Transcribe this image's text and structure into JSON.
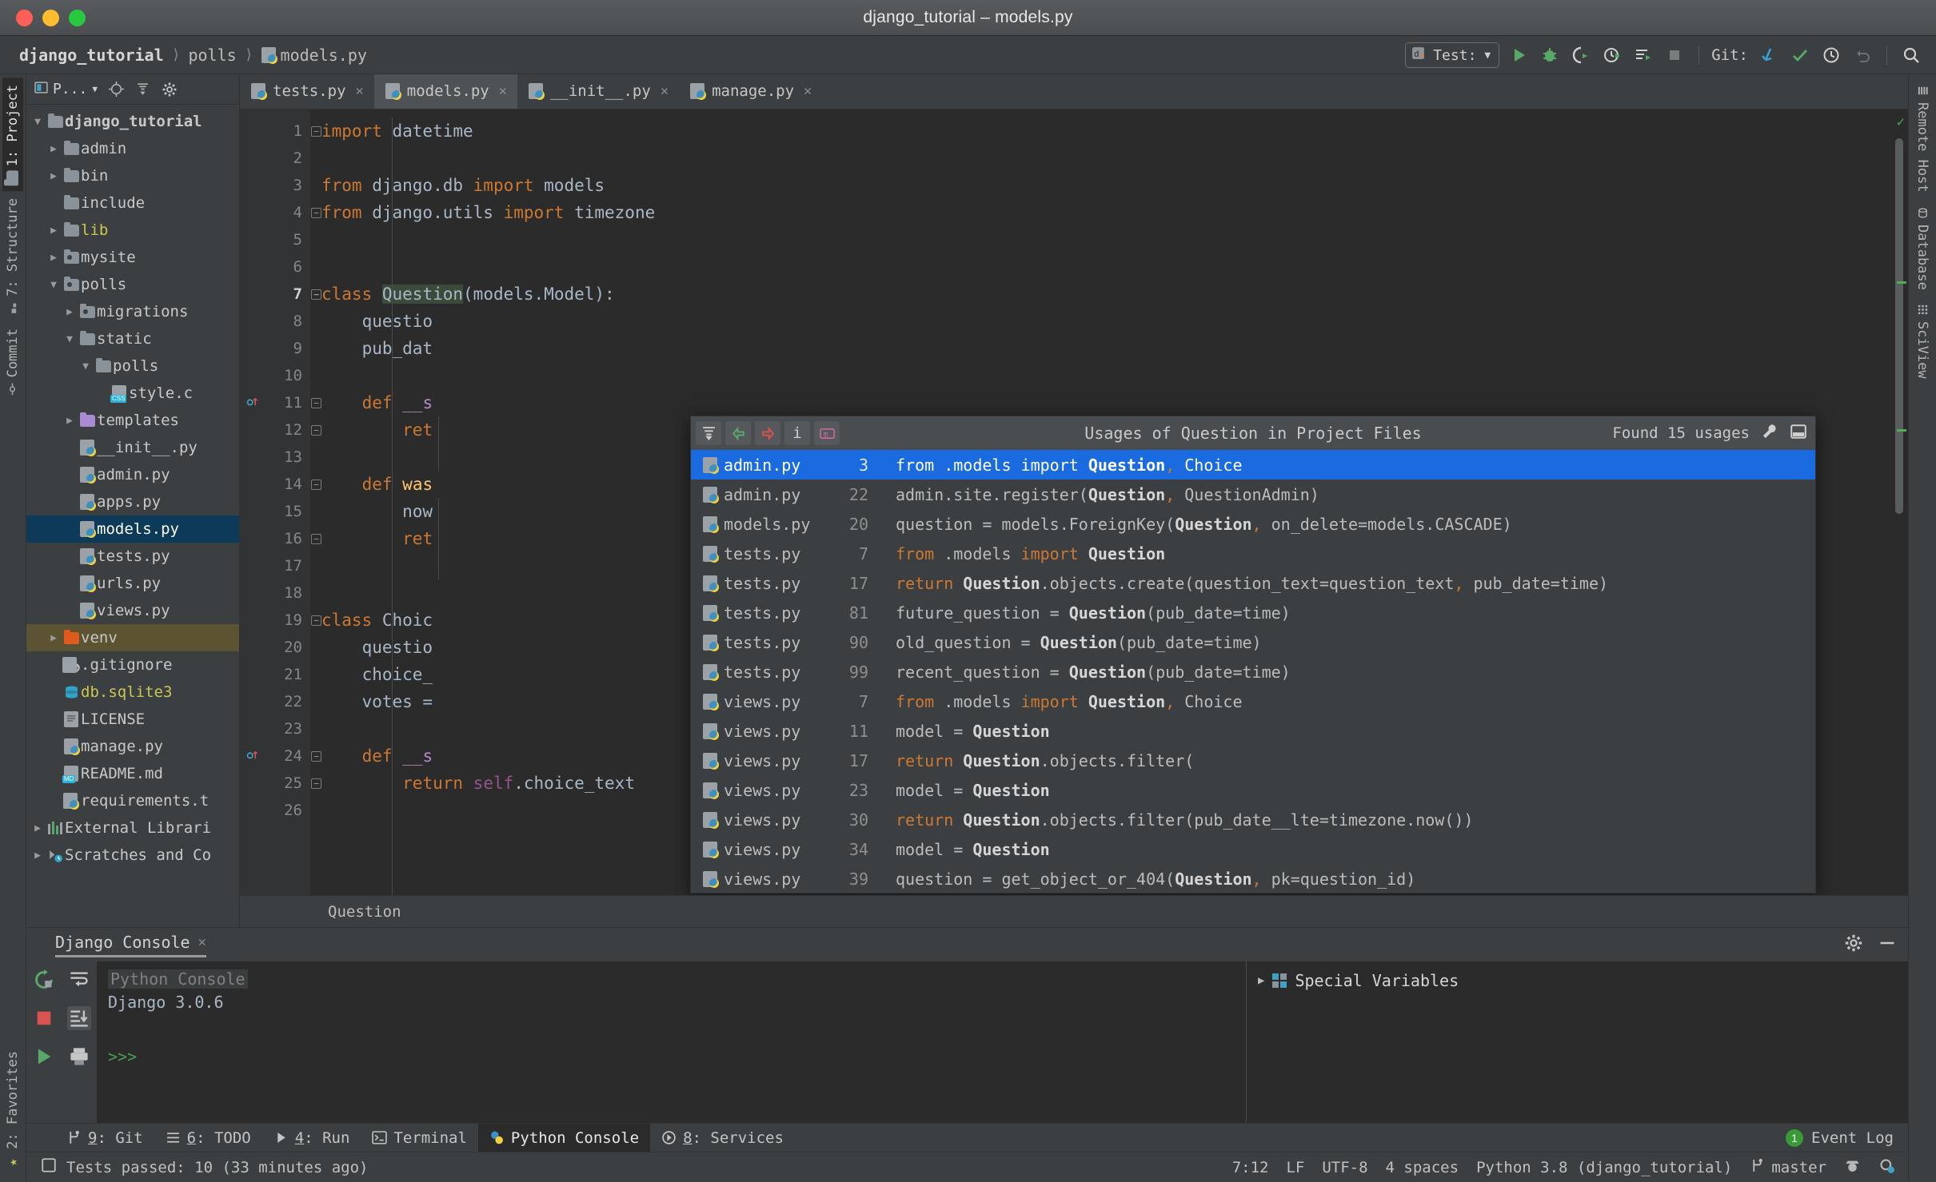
{
  "window": {
    "title": "django_tutorial – models.py",
    "traffic_lights": [
      "close",
      "minimize",
      "zoom"
    ]
  },
  "navbar": {
    "breadcrumbs": [
      "django_tutorial",
      "polls",
      "models.py"
    ],
    "run_config_label": "Test:",
    "git_label": "Git:",
    "icons": [
      "run-icon",
      "debug-icon",
      "run-coverage-icon",
      "profile-icon",
      "run-with-console-icon",
      "stop-icon",
      "git-update-icon",
      "git-commit-icon",
      "git-history-icon",
      "git-rollback-icon",
      "search-everywhere-icon"
    ]
  },
  "left_strip": {
    "tabs": [
      {
        "label": "1: Project",
        "icon": "folder-icon",
        "active": true
      },
      {
        "label": "7: Structure",
        "icon": "structure-icon",
        "active": false
      },
      {
        "label": "Commit",
        "icon": "commit-icon",
        "active": false
      }
    ],
    "bottom_tabs": [
      {
        "label": "2: Favorites",
        "icon": "star-icon"
      }
    ]
  },
  "right_strip": {
    "tabs": [
      {
        "label": "Remote Host",
        "icon": "remote-host-icon"
      },
      {
        "label": "Database",
        "icon": "database-icon"
      },
      {
        "label": "SciView",
        "icon": "sciview-icon"
      }
    ]
  },
  "project_pane": {
    "title": "P...",
    "header_icons": [
      "project-select-icon",
      "locate-icon",
      "collapse-all-icon",
      "settings-gear-icon"
    ],
    "tree": [
      {
        "label": "django_tutorial",
        "indent": 0,
        "arrow": "down",
        "icon": "folder-icon",
        "state": "normal"
      },
      {
        "label": "admin",
        "indent": 1,
        "arrow": "right",
        "icon": "folder-icon",
        "state": "normal"
      },
      {
        "label": "bin",
        "indent": 1,
        "arrow": "right",
        "icon": "folder-icon",
        "state": "normal"
      },
      {
        "label": "include",
        "indent": 1,
        "arrow": "none",
        "icon": "folder-icon",
        "state": "normal"
      },
      {
        "label": "lib",
        "indent": 1,
        "arrow": "right",
        "icon": "folder-icon",
        "state": "excluded"
      },
      {
        "label": "mysite",
        "indent": 1,
        "arrow": "right",
        "icon": "source-folder-icon",
        "state": "normal"
      },
      {
        "label": "polls",
        "indent": 1,
        "arrow": "down",
        "icon": "source-folder-icon",
        "state": "normal"
      },
      {
        "label": "migrations",
        "indent": 2,
        "arrow": "right",
        "icon": "source-folder-icon",
        "state": "normal"
      },
      {
        "label": "static",
        "indent": 2,
        "arrow": "down",
        "icon": "folder-icon",
        "state": "normal"
      },
      {
        "label": "polls",
        "indent": 3,
        "arrow": "down",
        "icon": "folder-icon",
        "state": "normal"
      },
      {
        "label": "style.c",
        "indent": 4,
        "arrow": "none",
        "icon": "css-file-icon",
        "state": "normal"
      },
      {
        "label": "templates",
        "indent": 2,
        "arrow": "right",
        "icon": "template-folder-icon",
        "state": "normal"
      },
      {
        "label": "__init__.py",
        "indent": 2,
        "arrow": "none",
        "icon": "python-file-icon",
        "state": "normal"
      },
      {
        "label": "admin.py",
        "indent": 2,
        "arrow": "none",
        "icon": "python-file-icon",
        "state": "normal"
      },
      {
        "label": "apps.py",
        "indent": 2,
        "arrow": "none",
        "icon": "python-file-icon",
        "state": "normal"
      },
      {
        "label": "models.py",
        "indent": 2,
        "arrow": "none",
        "icon": "python-file-icon",
        "state": "selected"
      },
      {
        "label": "tests.py",
        "indent": 2,
        "arrow": "none",
        "icon": "python-file-icon",
        "state": "normal"
      },
      {
        "label": "urls.py",
        "indent": 2,
        "arrow": "none",
        "icon": "python-file-icon",
        "state": "normal"
      },
      {
        "label": "views.py",
        "indent": 2,
        "arrow": "none",
        "icon": "python-file-icon",
        "state": "normal"
      },
      {
        "label": "venv",
        "indent": 1,
        "arrow": "right",
        "icon": "excluded-folder-icon",
        "state": "highlighted"
      },
      {
        "label": ".gitignore",
        "indent": 1,
        "arrow": "none",
        "icon": "ignored-file-icon",
        "state": "normal"
      },
      {
        "label": "db.sqlite3",
        "indent": 1,
        "arrow": "none",
        "icon": "database-file-icon",
        "state": "excluded"
      },
      {
        "label": "LICENSE",
        "indent": 1,
        "arrow": "none",
        "icon": "text-file-icon",
        "state": "normal"
      },
      {
        "label": "manage.py",
        "indent": 1,
        "arrow": "none",
        "icon": "python-file-icon",
        "state": "normal"
      },
      {
        "label": "README.md",
        "indent": 1,
        "arrow": "none",
        "icon": "markdown-file-icon",
        "state": "normal"
      },
      {
        "label": "requirements.t",
        "indent": 1,
        "arrow": "none",
        "icon": "requirements-file-icon",
        "state": "normal"
      },
      {
        "label": "External Librari",
        "indent": 0,
        "arrow": "right",
        "icon": "libraries-icon",
        "state": "normal"
      },
      {
        "label": "Scratches and Co",
        "indent": 0,
        "arrow": "right",
        "icon": "scratches-icon",
        "state": "normal"
      }
    ]
  },
  "editor": {
    "tabs": [
      {
        "label": "tests.py",
        "icon": "python-file-icon",
        "active": false
      },
      {
        "label": "models.py",
        "icon": "python-file-icon",
        "active": true
      },
      {
        "label": "__init__.py",
        "icon": "python-file-icon",
        "active": false
      },
      {
        "label": "manage.py",
        "icon": "python-file-icon",
        "active": false
      }
    ],
    "line_numbers": [
      1,
      2,
      3,
      4,
      5,
      6,
      7,
      8,
      9,
      10,
      11,
      12,
      13,
      14,
      15,
      16,
      17,
      18,
      19,
      20,
      21,
      22,
      23,
      24,
      25,
      26
    ],
    "current_line": 7,
    "breadcrumb": "Question",
    "code_lines": [
      "import datetime",
      "",
      "from django.db import models",
      "from django.utils import timezone",
      "",
      "",
      "class Question(models.Model):",
      "    questio",
      "    pub_dat",
      "",
      "    def __s",
      "        ret",
      "",
      "    def was",
      "        now",
      "        ret",
      "",
      "",
      "class Choic",
      "    questio",
      "    choice_",
      "    votes =",
      "",
      "    def __s",
      "        return self.choice_text",
      ""
    ]
  },
  "usages_popup": {
    "title": "Usages of Question in Project Files",
    "found_label": "Found 15 usages",
    "toolbar_icons": [
      "expand-all-icon",
      "previous-occurrence-icon",
      "next-occurrence-icon",
      "info-icon",
      "group-by-module-icon"
    ],
    "right_icons": [
      "settings-wrench-icon",
      "open-in-tool-window-icon"
    ],
    "rows": [
      {
        "file": "admin.py",
        "line": "3",
        "code": "from .models import Question, Choice",
        "selected": true
      },
      {
        "file": "admin.py",
        "line": "22",
        "code": "admin.site.register(Question, QuestionAdmin)",
        "selected": false
      },
      {
        "file": "models.py",
        "line": "20",
        "code": "question = models.ForeignKey(Question, on_delete=models.CASCADE)",
        "selected": false
      },
      {
        "file": "tests.py",
        "line": "7",
        "code": "from .models import Question",
        "selected": false
      },
      {
        "file": "tests.py",
        "line": "17",
        "code": "return Question.objects.create(question_text=question_text, pub_date=time)",
        "selected": false
      },
      {
        "file": "tests.py",
        "line": "81",
        "code": "future_question = Question(pub_date=time)",
        "selected": false
      },
      {
        "file": "tests.py",
        "line": "90",
        "code": "old_question = Question(pub_date=time)",
        "selected": false
      },
      {
        "file": "tests.py",
        "line": "99",
        "code": "recent_question = Question(pub_date=time)",
        "selected": false
      },
      {
        "file": "views.py",
        "line": "7",
        "code": "from .models import Question, Choice",
        "selected": false
      },
      {
        "file": "views.py",
        "line": "11",
        "code": "model = Question",
        "selected": false
      },
      {
        "file": "views.py",
        "line": "17",
        "code": "return Question.objects.filter(",
        "selected": false
      },
      {
        "file": "views.py",
        "line": "23",
        "code": "model = Question",
        "selected": false
      },
      {
        "file": "views.py",
        "line": "30",
        "code": "return Question.objects.filter(pub_date__lte=timezone.now())",
        "selected": false
      },
      {
        "file": "views.py",
        "line": "34",
        "code": "model = Question",
        "selected": false
      },
      {
        "file": "views.py",
        "line": "39",
        "code": "question = get_object_or_404(Question, pk=question_id)",
        "selected": false
      }
    ]
  },
  "console": {
    "tab_label": "Django Console",
    "header_icons": [
      "settings-gear-icon",
      "hide-icon"
    ],
    "gutter_icons": [
      "rerun-icon",
      "stop-icon",
      "execute-icon",
      "soft-wrap-icon",
      "scroll-to-end-icon",
      "print-icon"
    ],
    "output_title": "Python Console",
    "output_lines": [
      "Django 3.0.6"
    ],
    "prompt": ">>>",
    "variables_title": "Special Variables"
  },
  "toolstrip": {
    "items": [
      {
        "label": "9: Git",
        "icon": "git-icon",
        "active": false
      },
      {
        "label": "6: TODO",
        "icon": "todo-icon",
        "active": false
      },
      {
        "label": "4: Run",
        "icon": "run-icon",
        "active": false
      },
      {
        "label": "Terminal",
        "icon": "terminal-icon",
        "active": false
      },
      {
        "label": "Python Console",
        "icon": "python-icon",
        "active": true
      },
      {
        "label": "8: Services",
        "icon": "services-icon",
        "active": false
      }
    ],
    "event_log_label": "Event Log",
    "event_log_count": "1"
  },
  "statusbar": {
    "message": "Tests passed: 10 (33 minutes ago)",
    "caret_position": "7:12",
    "line_separator": "LF",
    "encoding": "UTF-8",
    "indent": "4 spaces",
    "interpreter": "Python 3.8 (django_tutorial)",
    "branch": "master",
    "right_icons": [
      "inspection-profile-icon",
      "settings-icon"
    ]
  },
  "colors": {
    "accent_blue": "#1a6ae0",
    "selection_blue": "#0d3a58",
    "keyword_orange": "#cc7832",
    "string_green": "#6a8759",
    "function_yellow": "#ffc66d",
    "editor_bg": "#2b2b2b",
    "chrome_bg": "#3c3f41"
  }
}
